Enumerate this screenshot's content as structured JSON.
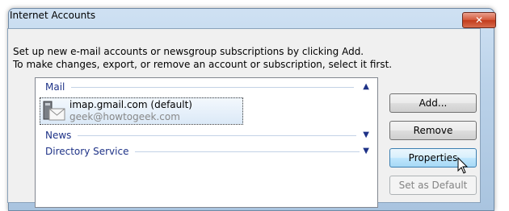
{
  "window": {
    "title": "Internet Accounts",
    "close_glyph": "✕"
  },
  "intro": {
    "line1": "Set up new e-mail accounts or newsgroup subscriptions by clicking Add.",
    "line2": "To make changes, export, or remove an account or subscription, select it first."
  },
  "groups": {
    "mail": {
      "label": "Mail",
      "chevron": "▲"
    },
    "news": {
      "label": "News",
      "chevron": "▼"
    },
    "directory": {
      "label": "Directory Service",
      "chevron": "▼"
    }
  },
  "account": {
    "name": "imap.gmail.com (default)",
    "email": "geek@howtogeek.com",
    "icon": "mail-account-icon"
  },
  "buttons": {
    "add": "Add...",
    "remove": "Remove",
    "properties": "Properties",
    "set_default": "Set as Default"
  },
  "colors": {
    "group_text": "#1e3287",
    "close_button": "#c23b1c",
    "hot_button": "#bee6fd"
  }
}
